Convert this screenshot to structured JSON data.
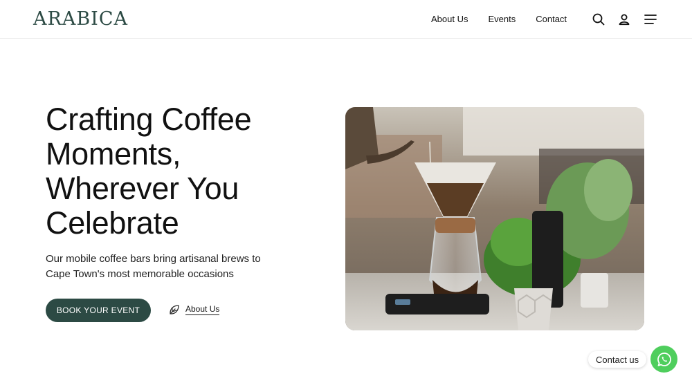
{
  "header": {
    "logo": "ARABICA",
    "nav": [
      {
        "label": "About Us"
      },
      {
        "label": "Events"
      },
      {
        "label": "Contact"
      }
    ],
    "icons": [
      "search-icon",
      "account-icon",
      "menu-icon"
    ]
  },
  "hero": {
    "title": "Crafting Coffee Moments, Wherever You Celebrate",
    "subtitle": "Our mobile coffee bars bring artisanal brews to Cape Town's most memorable occasions",
    "cta_primary": "BOOK YOUR EVENT",
    "cta_secondary": "About Us",
    "cta_secondary_icon": "leaf-icon",
    "image": "pour-over-coffee-photo"
  },
  "chat": {
    "label": "Contact us",
    "icon": "whatsapp-icon"
  },
  "colors": {
    "brand": "#2c4a44",
    "whatsapp": "#4fce5d"
  }
}
